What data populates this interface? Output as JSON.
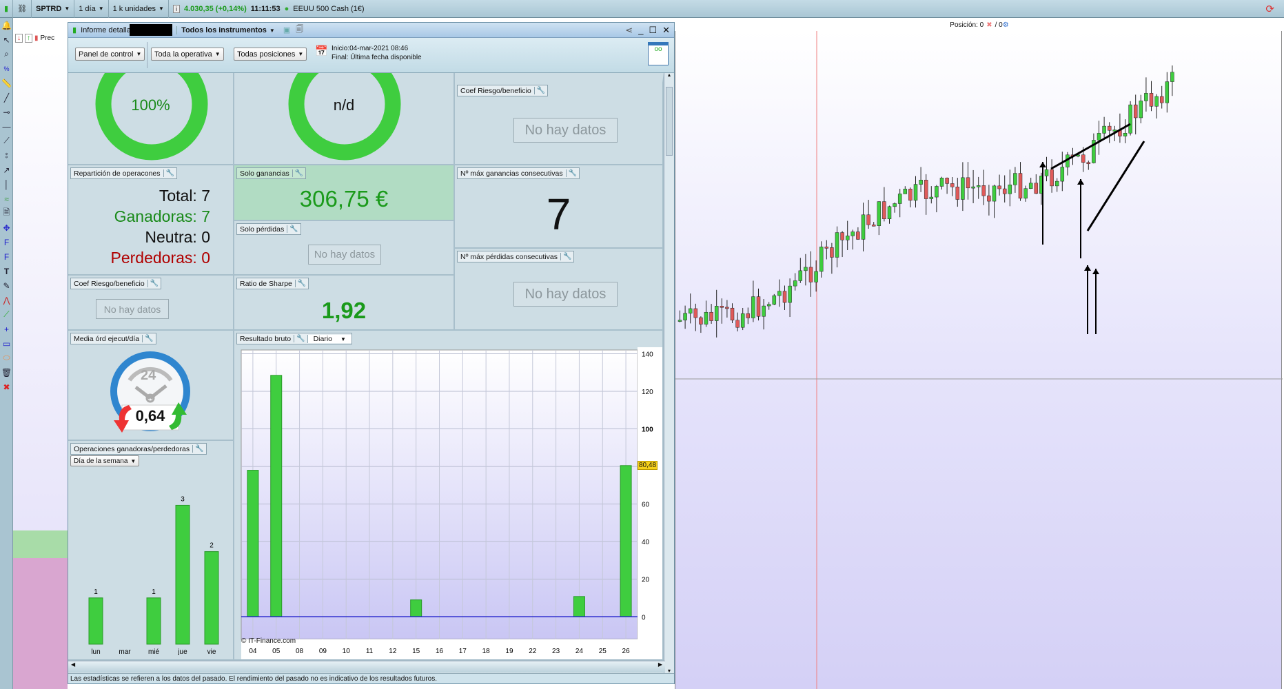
{
  "topbar": {
    "symbol": "SPTRD",
    "period": "1 día",
    "units": "1 k unidades",
    "price": "4.030,35 (+0,14%)",
    "time": "11:11:53",
    "instrument": "EEUU 500 Cash (1€)"
  },
  "chart_header": {
    "position_label": "Posición:",
    "position_value": "0",
    "orders_value": "/ 0",
    "mini_label": "Prec"
  },
  "window": {
    "title": "Informe detallado",
    "instrument_selector": "Todos los instrumentos",
    "toolbar": {
      "panel": "Panel de control",
      "operativa": "Toda la operativa",
      "posiciones": "Todas posiciones",
      "inicio": "Inicio:04-mar-2021 08:46",
      "final": "Final: Última fecha disponible"
    },
    "donut1": {
      "value": "100%",
      "fraction": 1.0
    },
    "donut2": {
      "value": "n/d"
    },
    "coef_top": {
      "label": "Coef Riesgo/beneficio",
      "value": "No hay datos"
    },
    "reparticion": {
      "label": "Repartición de operacones",
      "total": "Total: 7",
      "ganadoras": "Ganadoras: 7",
      "neutra": "Neutra: 0",
      "perdedoras": "Perdedoras: 0"
    },
    "solo_ganancias": {
      "label": "Solo ganancias",
      "value": "306,75 €"
    },
    "solo_perdidas": {
      "label": "Solo pérdidas",
      "value": "No hay datos"
    },
    "max_ganancias": {
      "label": "Nº máx ganancias consecutivas",
      "value": "7"
    },
    "max_perdidas": {
      "label": "Nº máx pérdidas consecutivas",
      "value": "No hay datos"
    },
    "coef_left": {
      "label": "Coef Riesgo/beneficio",
      "value": "No hay datos"
    },
    "sharpe": {
      "label": "Ratio de Sharpe",
      "value": "1,92"
    },
    "media": {
      "label": "Media órd ejecut/día",
      "value": "0,64",
      "dial": "24"
    },
    "ops": {
      "label": "Operaciones ganadoras/perdedoras",
      "selector": "Día de la semana"
    },
    "resultado": {
      "label": "Resultado bruto",
      "selector": "Diario",
      "credit": "© IT-Finance.com",
      "marker": "80,48"
    },
    "footer": "Las estadísticas se refieren a los datos del pasado. El rendimiento del pasado no es indicativo de los resultados futuros."
  },
  "chart_data": [
    {
      "type": "bar",
      "categories": [
        "lun",
        "mar",
        "mié",
        "jue",
        "vie"
      ],
      "values": [
        1,
        0,
        1,
        3,
        2
      ]
    },
    {
      "type": "bar",
      "categories": [
        "04",
        "05",
        "08",
        "09",
        "10",
        "11",
        "12",
        "15",
        "16",
        "17",
        "18",
        "19",
        "22",
        "23",
        "24",
        "25",
        "26"
      ],
      "values": [
        78,
        128.5,
        0,
        0,
        0,
        0,
        0,
        9,
        0,
        0,
        0,
        0,
        0,
        0,
        10.8,
        0,
        80.48
      ],
      "yticks": [
        0,
        20,
        40,
        60,
        80,
        100,
        120,
        140
      ],
      "ylim": [
        -12,
        142
      ],
      "grid": true
    }
  ],
  "colors": {
    "green": "#3fcd3f",
    "loss": "#b00000",
    "accent": "#1a8a1a"
  }
}
